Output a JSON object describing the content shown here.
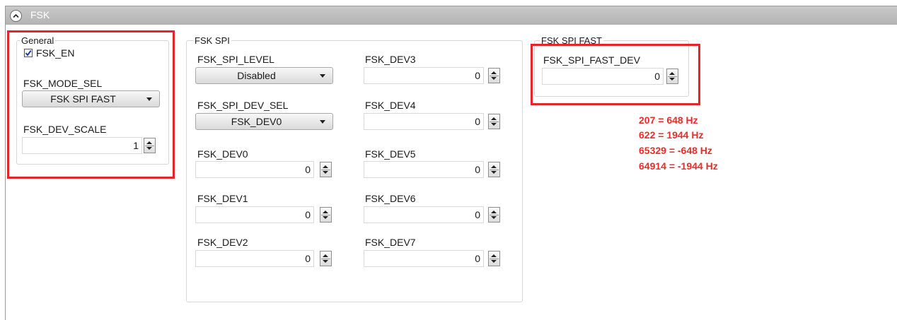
{
  "header": {
    "title": "FSK"
  },
  "general": {
    "group_title": "General",
    "fsk_en_label": "FSK_EN",
    "fsk_en_checked": true,
    "mode_sel_label": "FSK_MODE_SEL",
    "mode_sel_value": "FSK SPI FAST",
    "dev_scale_label": "FSK_DEV_SCALE",
    "dev_scale_value": "1"
  },
  "fsk_spi": {
    "group_title": "FSK SPI",
    "level_label": "FSK_SPI_LEVEL",
    "level_value": "Disabled",
    "dev_sel_label": "FSK_SPI_DEV_SEL",
    "dev_sel_value": "FSK_DEV0",
    "dev0": {
      "label": "FSK_DEV0",
      "value": "0"
    },
    "dev1": {
      "label": "FSK_DEV1",
      "value": "0"
    },
    "dev2": {
      "label": "FSK_DEV2",
      "value": "0"
    },
    "dev3": {
      "label": "FSK_DEV3",
      "value": "0"
    },
    "dev4": {
      "label": "FSK_DEV4",
      "value": "0"
    },
    "dev5": {
      "label": "FSK_DEV5",
      "value": "0"
    },
    "dev6": {
      "label": "FSK_DEV6",
      "value": "0"
    },
    "dev7": {
      "label": "FSK_DEV7",
      "value": "0"
    }
  },
  "fsk_spi_fast": {
    "group_title": "FSK SPI FAST",
    "fast_dev_label": "FSK_SPI_FAST_DEV",
    "fast_dev_value": "0"
  },
  "annotations": {
    "lines": [
      "207 = 648 Hz",
      "622 = 1944 Hz",
      "65329 = -648 Hz",
      "64914 = -1944 Hz"
    ],
    "highlight_color": "#e4262b"
  },
  "colors": {
    "header_bg": "#bdbdbd",
    "annotation_text": "#ee2a2a"
  }
}
